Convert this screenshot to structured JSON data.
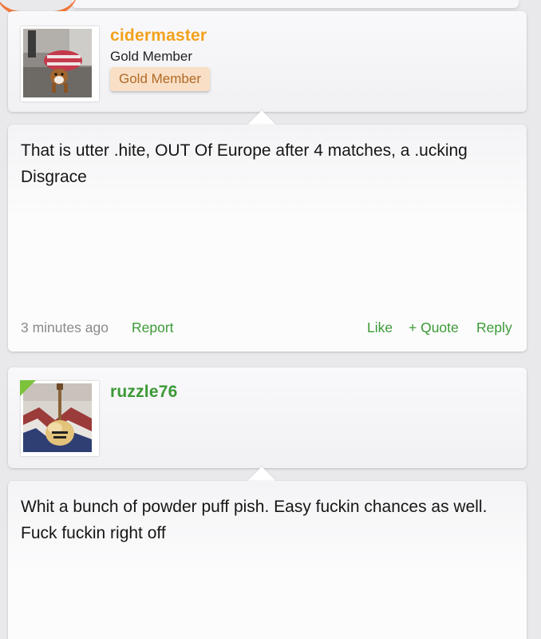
{
  "posts": [
    {
      "author": {
        "name": "cidermaster",
        "name_color": "#f2a11c",
        "title": "Gold Member",
        "badge": "Gold Member",
        "avatar_icon": "bulldog-in-sweater-photo"
      },
      "body": "That is utter .hite, OUT Of Europe after 4 matches, a .ucking Disgrace",
      "time": "3 minutes ago",
      "report_label": "Report",
      "like_label": "Like",
      "quote_label": "+ Quote",
      "reply_label": "Reply"
    },
    {
      "author": {
        "name": "ruzzle76",
        "name_color": "#3c9a36",
        "avatar_icon": "guitar-photo",
        "online_indicator_color": "#7cc23b"
      },
      "body": "Whit a bunch of powder puff pish. Easy fuckin chances as well. Fuck fuckin right off"
    }
  ],
  "colors": {
    "action_green": "#3c9a36",
    "badge_bg": "#f9dfc6",
    "badge_text": "#b06a25",
    "page_bg": "#e9e9ec"
  }
}
